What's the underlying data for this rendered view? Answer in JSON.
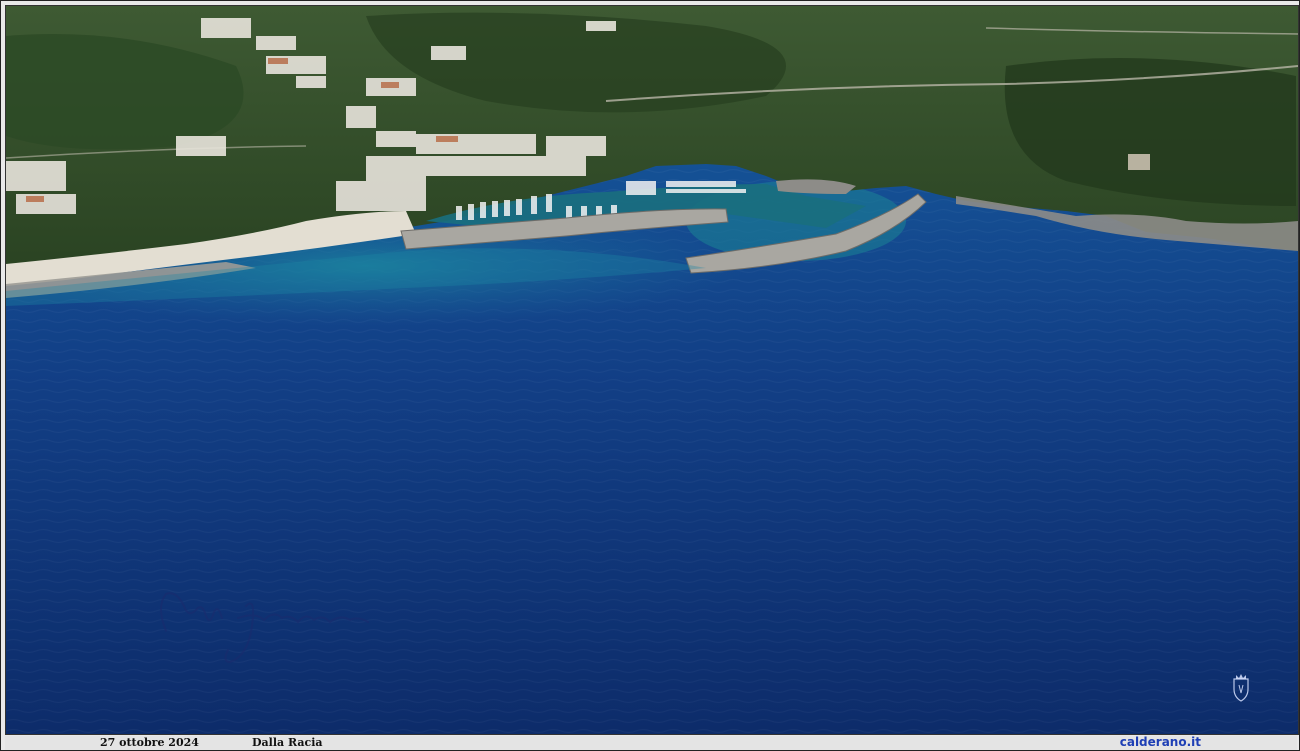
{
  "photo": {
    "subject": "aerial-sea-harbour",
    "colors": {
      "sea_deep": "#0c2f6e",
      "sea_mid": "#124a8a",
      "sea_shallow": "#1f7f9a",
      "vegetation": "#2f4a26",
      "beach": "#e7e3d8",
      "rock": "#8a8a86"
    },
    "signature_icon": "handwritten-signature",
    "crest_icon": "coat-of-arms-icon"
  },
  "caption": {
    "date": "27 ottobre 2024",
    "place": "Dalla Racia",
    "site": "calderano.it"
  },
  "colors": {
    "caption_bg": "#e4e4e4",
    "site_link": "#1e3fb5"
  }
}
